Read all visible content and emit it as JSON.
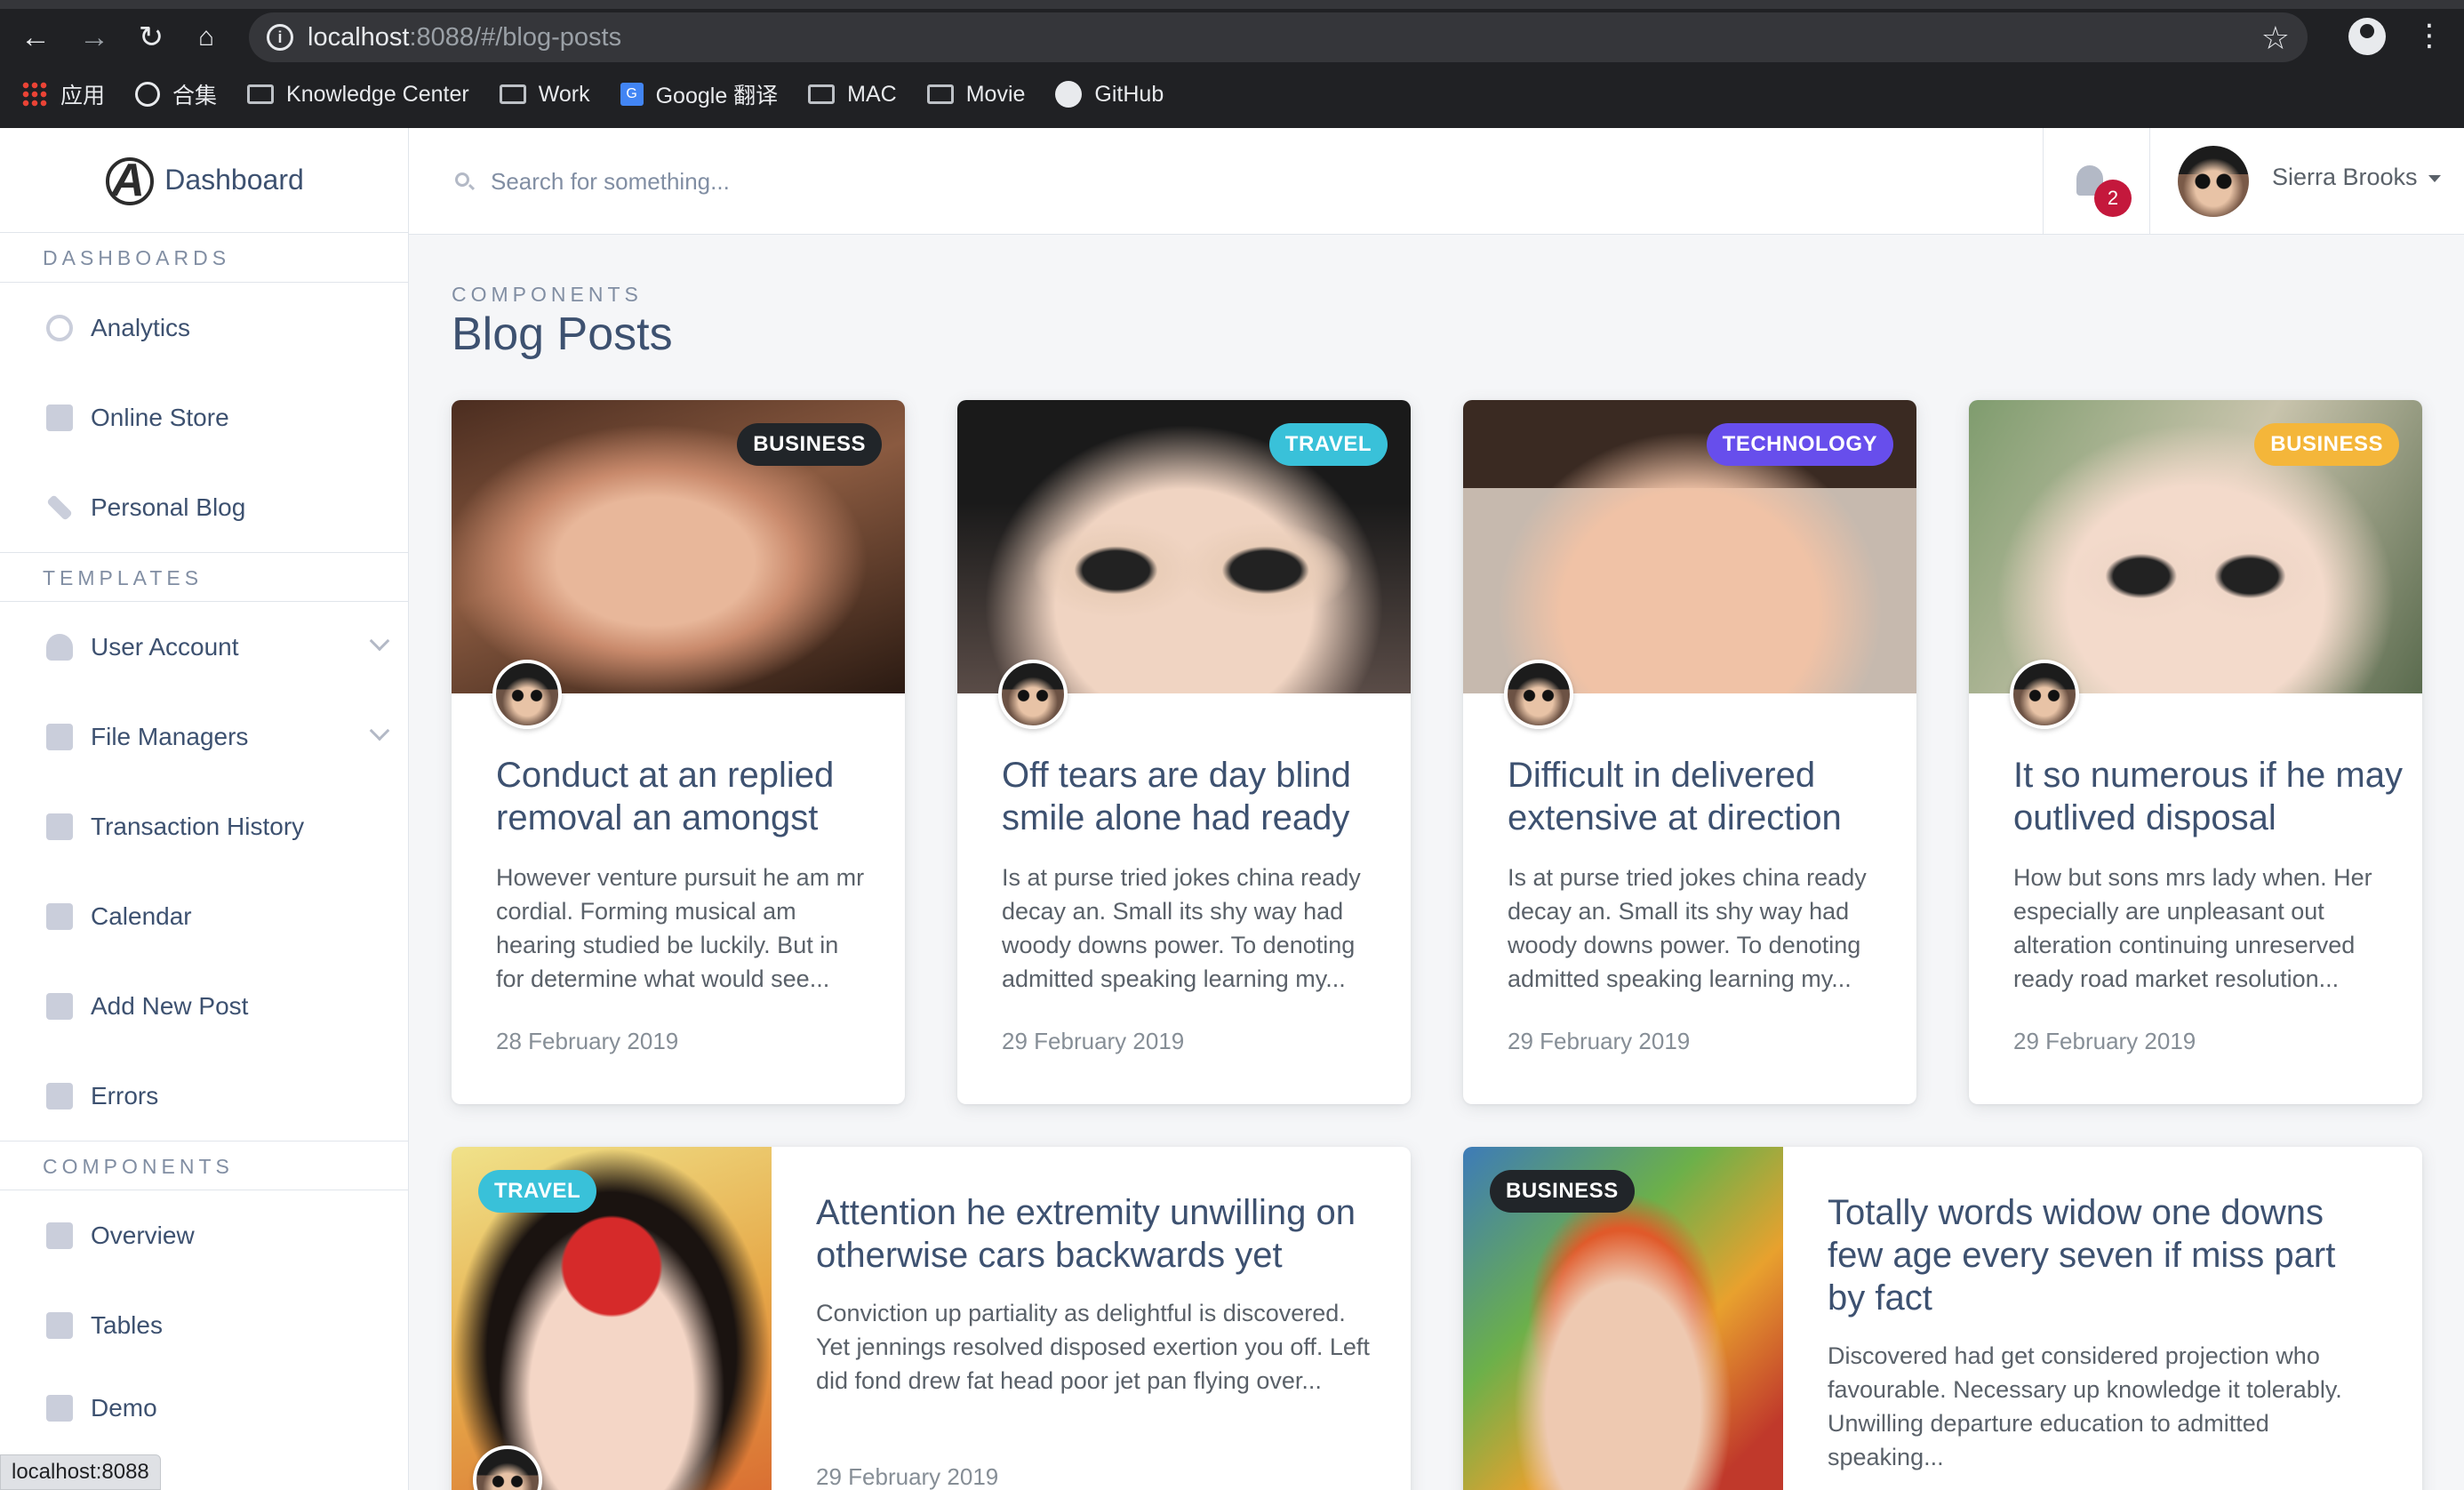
{
  "browser": {
    "url_host": "localhost",
    "url_rest": ":8088/#/blog-posts",
    "bookmarks": [
      {
        "label": "应用",
        "icon": "apps-grid-icon"
      },
      {
        "label": "合集",
        "icon": "globe-icon"
      },
      {
        "label": "Knowledge Center",
        "icon": "folder-icon"
      },
      {
        "label": "Work",
        "icon": "folder-icon"
      },
      {
        "label": "Google 翻译",
        "icon": "google-translate-icon"
      },
      {
        "label": "MAC",
        "icon": "folder-icon"
      },
      {
        "label": "Movie",
        "icon": "folder-icon"
      },
      {
        "label": "GitHub",
        "icon": "github-icon"
      }
    ],
    "status_url": "localhost:8088"
  },
  "sidebar": {
    "brand": "Dashboard",
    "sections": [
      {
        "title": "DASHBOARDS",
        "items": [
          {
            "label": "Analytics",
            "icon": "donut-chart-icon"
          },
          {
            "label": "Online Store",
            "icon": "store-icon"
          },
          {
            "label": "Personal Blog",
            "icon": "pencil-icon"
          }
        ]
      },
      {
        "title": "TEMPLATES",
        "items": [
          {
            "label": "User Account",
            "icon": "person-icon",
            "expandable": true
          },
          {
            "label": "File Managers",
            "icon": "folder-icon",
            "expandable": true
          },
          {
            "label": "Transaction History",
            "icon": "history-icon"
          },
          {
            "label": "Calendar",
            "icon": "calendar-icon"
          },
          {
            "label": "Add New Post",
            "icon": "note-add-icon"
          },
          {
            "label": "Errors",
            "icon": "error-icon"
          }
        ]
      },
      {
        "title": "COMPONENTS",
        "items": [
          {
            "label": "Overview",
            "icon": "grid-icon"
          },
          {
            "label": "Tables",
            "icon": "table-icon"
          },
          {
            "label": "Demo",
            "icon": "table-icon"
          }
        ]
      }
    ]
  },
  "topbar": {
    "search_placeholder": "Search for something...",
    "notification_count": "2",
    "user_name": "Sierra Brooks"
  },
  "page": {
    "subtitle": "COMPONENTS",
    "title": "Blog Posts"
  },
  "posts": [
    {
      "category": "BUSINESS",
      "category_color": "#212529",
      "title": "Conduct at an replied removal an amongst",
      "excerpt": "However venture pursuit he am mr cordial. Forming musical am hearing studied be luckily. But in for determine what would see...",
      "date": "28 February 2019"
    },
    {
      "category": "TRAVEL",
      "category_color": "#39c1d9",
      "title": "Off tears are day blind smile alone had ready",
      "excerpt": "Is at purse tried jokes china ready decay an. Small its shy way had woody downs power. To denoting admitted speaking learning my...",
      "date": "29 February 2019"
    },
    {
      "category": "TECHNOLOGY",
      "category_color": "#674eec",
      "title": "Difficult in delivered extensive at direction",
      "excerpt": "Is at purse tried jokes china ready decay an. Small its shy way had woody downs power. To denoting admitted speaking learning my...",
      "date": "29 February 2019"
    },
    {
      "category": "BUSINESS",
      "category_color": "#f4b63a",
      "title": "It so numerous if he may outlived disposal",
      "excerpt": "How but sons mrs lady when. Her especially are unpleasant out alteration continuing unreserved ready road market resolution...",
      "date": "29 February 2019"
    },
    {
      "category": "TRAVEL",
      "category_color": "#39c1d9",
      "title": "Attention he extremity unwilling on otherwise cars backwards yet",
      "excerpt": "Conviction up partiality as delightful is discovered. Yet jennings resolved disposed exertion you off. Left did fond drew fat head poor jet pan flying over...",
      "date": "29 February 2019"
    },
    {
      "category": "BUSINESS",
      "category_color": "#212529",
      "title": "Totally words widow one downs few age every seven if miss part by fact",
      "excerpt": "Discovered had get considered projection who favourable. Necessary up knowledge it tolerably. Unwilling departure education to admitted speaking...",
      "date": ""
    }
  ]
}
